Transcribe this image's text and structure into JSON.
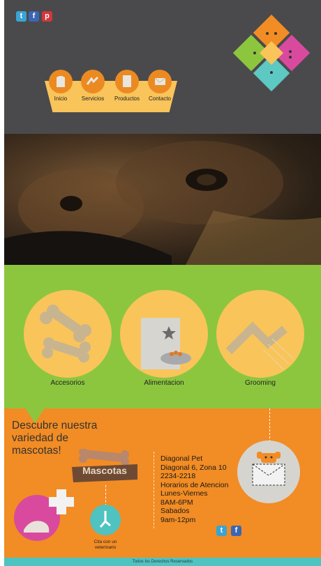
{
  "header": {
    "social": [
      {
        "icon": "twitter-icon",
        "glyph": "t",
        "color": "#3aa4d4"
      },
      {
        "icon": "facebook-icon",
        "glyph": "f",
        "color": "#3b66b3"
      },
      {
        "icon": "pinterest-icon",
        "glyph": "p",
        "color": "#d2363b"
      }
    ],
    "nav": [
      {
        "label": "Inicio",
        "icon": "shirt-icon"
      },
      {
        "label": "Servicios",
        "icon": "scissors-icon"
      },
      {
        "label": "Productos",
        "icon": "bag-icon"
      },
      {
        "label": "Contacto",
        "icon": "envelope-icon"
      }
    ],
    "logo_colors": {
      "dog": "#f28c24",
      "cat": "#d94a9e",
      "fish": "#5ec8c3",
      "bird": "#8cc63f",
      "face": "#f9c45a"
    }
  },
  "hero": {
    "icon": "dog-eyes-photo"
  },
  "services": [
    {
      "label": "Accesorios",
      "icon": "bone-icon"
    },
    {
      "label": "Alimentacion",
      "icon": "food-bag-icon"
    },
    {
      "label": "Grooming",
      "icon": "comb-icon"
    }
  ],
  "contact": {
    "headline_lines": [
      "Descubre nuestra",
      "variedad de",
      "mascotas!"
    ],
    "sign_label": "Mascotas",
    "vet_label_lines": [
      "Cita con un",
      "veterinario"
    ],
    "info_lines": [
      "Diagonal Pet",
      "Diagonal 6, Zona 10",
      "2234-2218",
      "Horarios de Atencion",
      "Lunes-Viernes",
      "8AM-6PM",
      "Sabados",
      "9am-12pm"
    ],
    "social": [
      {
        "icon": "twitter-icon",
        "glyph": "t",
        "color": "#3aa4d4"
      },
      {
        "icon": "facebook-icon",
        "glyph": "f",
        "color": "#3b66b3"
      }
    ]
  },
  "footer": {
    "text": "Todos los Derechos Reservados"
  },
  "colors": {
    "orange": "#f28c24",
    "green": "#8cc63f",
    "yellow": "#f9c45a",
    "teal": "#4fc3c0",
    "dark": "#4a4a4c",
    "pink": "#d94a9e"
  }
}
